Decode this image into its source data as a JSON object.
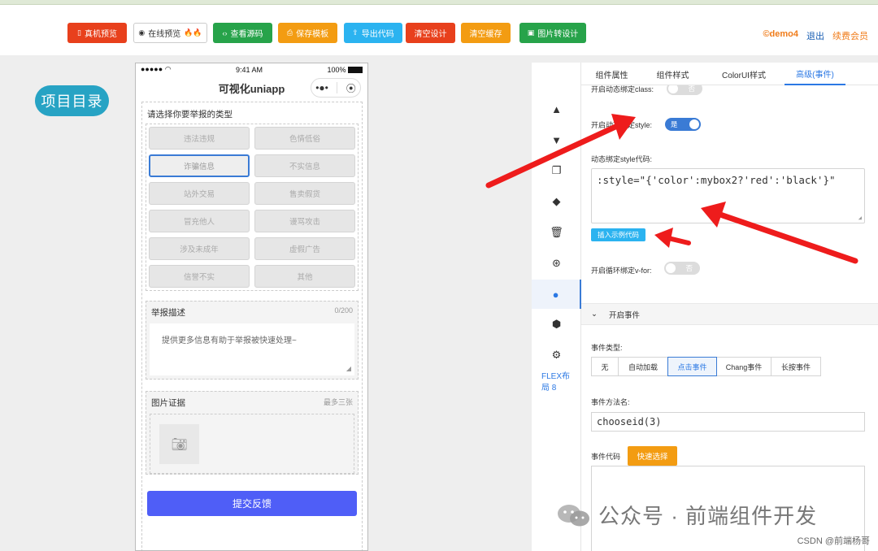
{
  "toolbar": {
    "buttons": [
      {
        "label": "真机预览",
        "icon": "phone-icon",
        "color": "#e8401c"
      },
      {
        "label": "在线预览",
        "icon": "eye-icon",
        "color": "#ffffff"
      },
      {
        "label": "查看源码",
        "icon": "code-icon",
        "color": "#27a34a"
      },
      {
        "label": "保存模板",
        "icon": "save-icon",
        "color": "#f39c12"
      },
      {
        "label": "导出代码",
        "icon": "export-icon",
        "color": "#2bb3f0"
      },
      {
        "label": "清空设计",
        "color": "#e8401c"
      },
      {
        "label": "清空缓存",
        "color": "#f39c12"
      },
      {
        "label": "图片转设计",
        "icon": "image-icon",
        "color": "#27a34a"
      }
    ],
    "user": {
      "name": "©demo4",
      "logout": "退出",
      "renew": "续费会员"
    }
  },
  "catalog_button": "项目目录",
  "phone": {
    "status": {
      "carrier": "●●●●● ",
      "time": "9:41 AM",
      "battery": "100%"
    },
    "title": "可视化uniapp",
    "capsule": {
      "more": "•●•",
      "close": "⦿"
    },
    "report_type_label": "请选择你要举报的类型",
    "report_types": [
      "违法违规",
      "色情低俗",
      "诈骗信息",
      "不实信息",
      "站外交易",
      "售卖假货",
      "冒充他人",
      "谩骂攻击",
      "涉及未成年",
      "虚假广告",
      "信誉不实",
      "其他"
    ],
    "selected_type": "诈骗信息",
    "description": {
      "label": "举报描述",
      "count": "0/200",
      "placeholder": "提供更多信息有助于举报被快速处理~"
    },
    "images": {
      "label": "图片证据",
      "limit": "最多三张"
    },
    "submit": "提交反馈"
  },
  "sidebar": {
    "icons": [
      "arrow-up-icon",
      "arrow-down-icon",
      "copy-icon",
      "store-icon",
      "trash-icon",
      "aperture-icon",
      "clock-icon",
      "angular-icon",
      "gear-icon"
    ],
    "active_icon": "clock-icon",
    "flex_label": "FLEX布局 8"
  },
  "tabs": [
    "组件属性",
    "组件样式",
    "ColorUI样式",
    "高级(事件)"
  ],
  "active_tab": "高级(事件)",
  "props": {
    "dyn_class_label": "开启动态绑定class:",
    "dyn_class_value": "否",
    "dyn_style_label": "开启动态绑定style:",
    "dyn_style_value": "是",
    "style_code_label": "动态绑定style代码:",
    "style_code_value": ":style=\"{'color':mybox2?'red':'black'}\"",
    "insert_example": "插入示例代码",
    "vfor_label": "开启循环绑定v-for:",
    "vfor_value": "否",
    "event_section": "开启事件",
    "event_type_label": "事件类型:",
    "event_types": [
      "无",
      "自动加载",
      "点击事件",
      "Chang事件",
      "长按事件"
    ],
    "active_event": "点击事件",
    "method_label": "事件方法名:",
    "method_value": "chooseid(3)",
    "event_code_label": "事件代码",
    "quick_select": "快速选择"
  },
  "watermark": {
    "text": "公众号 · 前端组件开发",
    "csdn": "CSDN @前端杨哥"
  },
  "annotation_color": "#ee1c1c"
}
